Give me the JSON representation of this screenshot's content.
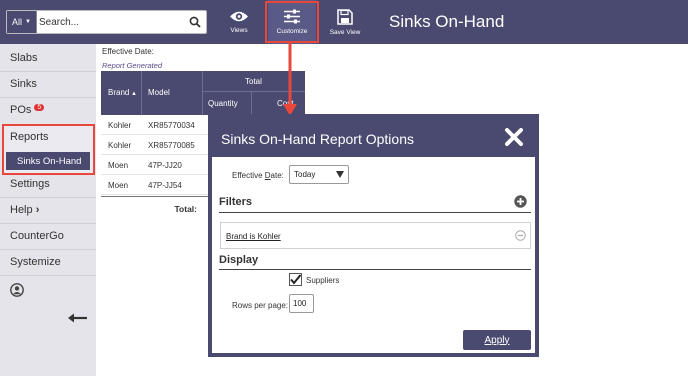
{
  "header": {
    "search_scope": "All",
    "search_placeholder": "Search...",
    "tools": {
      "views_label": "Views",
      "customize_label": "Customize",
      "save_view_label": "Save View"
    },
    "page_title": "Sinks On-Hand"
  },
  "sidebar": {
    "items": [
      {
        "label": "Slabs"
      },
      {
        "label": "Sinks"
      },
      {
        "label": "POs",
        "badge": "5"
      },
      {
        "label": "Reports"
      },
      {
        "label": "Sinks On-Hand"
      },
      {
        "label": "Settings"
      },
      {
        "label": "Help"
      },
      {
        "label": "CounterGo"
      },
      {
        "label": "Systemize"
      }
    ],
    "help_chevron": "›"
  },
  "report": {
    "effective_date_label": "Effective Date:",
    "report_generated": "Report Generated",
    "columns": {
      "brand": "Brand",
      "model": "Model",
      "total": "Total",
      "quantity": "Quantity",
      "cost": "Cost"
    },
    "rows": [
      {
        "brand": "Kohler",
        "model": "XR85770034"
      },
      {
        "brand": "Kohler",
        "model": "XR85770085"
      },
      {
        "brand": "Moen",
        "model": "47P-JJ20"
      },
      {
        "brand": "Moen",
        "model": "47P-JJ54"
      }
    ],
    "total_label": "Total:"
  },
  "dialog": {
    "title": "Sinks On-Hand Report Options",
    "effective_date": {
      "label_prefix": "Effective ",
      "label_underlined": "D",
      "label_suffix": "ate:",
      "selected": "Today"
    },
    "filters_title": "Filters",
    "filters": [
      "Brand is Kohler"
    ],
    "display_title": "Display",
    "suppliers_label": "Suppliers",
    "suppliers_checked": true,
    "rows_per_page_label": "Rows per page:",
    "rows_per_page": "100",
    "apply_label": "Apply"
  },
  "colors": {
    "primary": "#4a4a70",
    "highlight": "#e8473c",
    "sidebar_bg": "#e4e4ea",
    "badge": "#dd3333"
  }
}
